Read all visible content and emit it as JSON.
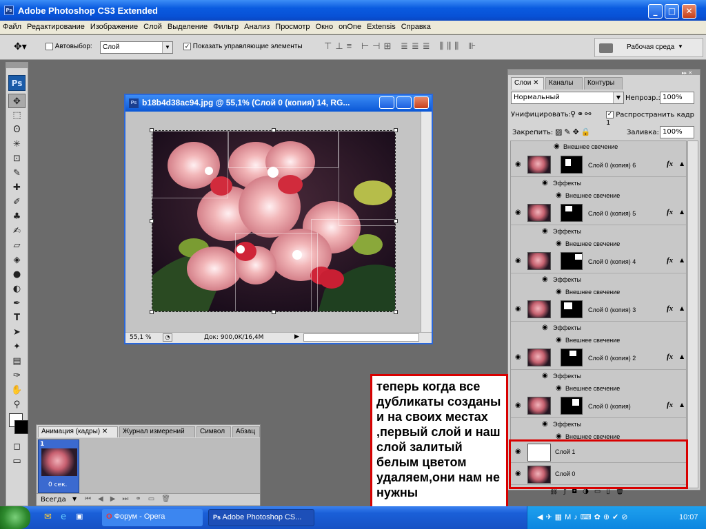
{
  "app": {
    "title": "Adobe Photoshop CS3 Extended",
    "icon": "ps-icon"
  },
  "window_buttons": {
    "minimize": "_",
    "maximize": "□",
    "close": "✕"
  },
  "menu": [
    "Файл",
    "Редактирование",
    "Изображение",
    "Слой",
    "Выделение",
    "Фильтр",
    "Анализ",
    "Просмотр",
    "Окно",
    "onOne",
    "Extensis",
    "Справка"
  ],
  "options": {
    "autoselect_label": "Автовыбор:",
    "autoselect_value": "Слой",
    "show_controls_label": "Показать управляющие элементы",
    "workspace_label": "Рабочая среда"
  },
  "document": {
    "title": "b18b4d38ac94.jpg @ 55,1% (Слой 0 (копия) 14, RG...",
    "zoom": "55,1 %",
    "doc_info": "Док: 900,0K/16,4M"
  },
  "layers_panel": {
    "tabs": [
      "Слои",
      "Каналы",
      "Контуры"
    ],
    "blend_mode": "Нормальный",
    "opacity_label": "Непрозр.:",
    "opacity": "100%",
    "unify_label": "Унифицировать:",
    "propagate_label": "Распространить кадр 1",
    "lock_label": "Закрепить:",
    "fill_label": "Заливка:",
    "fill": "100%",
    "top_effect": "Внешнее свечение",
    "layers": [
      {
        "name": "Слой 0 (копия) 6",
        "effects": "Эффекты",
        "glow": "Внешнее свечение"
      },
      {
        "name": "Слой 0 (копия) 5",
        "effects": "Эффекты",
        "glow": "Внешнее свечение"
      },
      {
        "name": "Слой 0 (копия) 4",
        "effects": "Эффекты",
        "glow": "Внешнее свечение"
      },
      {
        "name": "Слой 0 (копия) 3",
        "effects": "Эффекты",
        "glow": "Внешнее свечение"
      },
      {
        "name": "Слой 0 (копия) 2",
        "effects": "Эффекты",
        "glow": "Внешнее свечение"
      },
      {
        "name": "Слой 0 (копия)",
        "effects": "Эффекты",
        "glow": "Внешнее свечение"
      }
    ],
    "plain_layers": [
      "Слой 1",
      "Слой 0"
    ],
    "fx_label": "fx"
  },
  "animation_panel": {
    "tabs": [
      "Анимация (кадры)",
      "Журнал измерений",
      "Символ",
      "Абзац"
    ],
    "frame_number": "1",
    "frame_delay": "0 сек.",
    "loop": "Всегда"
  },
  "taskbar": {
    "items": [
      "Форум - Opera",
      "Adobe Photoshop CS..."
    ],
    "clock": "10:07"
  },
  "annotation": {
    "text": "теперь когда все дубликаты созданы и на своих местах ,первый слой и наш слой залитый белым цветом удаляем,они нам не нужны",
    "color": "#d80000"
  }
}
